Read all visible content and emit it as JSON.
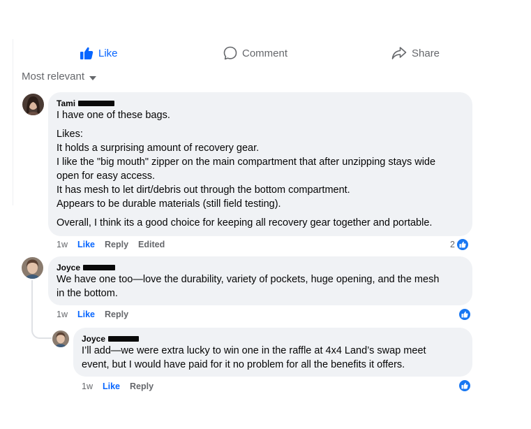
{
  "actions": {
    "like_label": "Like",
    "comment_label": "Comment",
    "share_label": "Share"
  },
  "sort": {
    "label": "Most relevant"
  },
  "comments": [
    {
      "author": "Tami",
      "paragraphs": [
        [
          "I have one of these bags."
        ],
        [
          "Likes:",
          "It holds a surprising amount of recovery gear.",
          "I like the \"big mouth\" zipper on the main compartment that after unzipping stays wide",
          "open for easy access.",
          "It has mesh to let dirt/debris out through the bottom compartment.",
          "Appears to be durable materials (still field testing)."
        ],
        [
          "Overall, I think its a good choice for keeping all recovery gear together and portable."
        ]
      ],
      "time": "1w",
      "like": "Like",
      "reply": "Reply",
      "edited": "Edited",
      "reaction_count": "2"
    },
    {
      "author": "Joyce",
      "lines": [
        "We have one too—love the durability, variety of pockets, huge opening, and the mesh",
        "in the bottom."
      ],
      "time": "1w",
      "like": "Like",
      "reply": "Reply"
    },
    {
      "author": "Joyce",
      "lines": [
        "I’ll add—we were extra lucky to win one in the raffle at 4x4 Land’s swap meet",
        "event, but I would have paid for it no problem for all the benefits it offers."
      ],
      "time": "1w",
      "like": "Like",
      "reply": "Reply"
    }
  ],
  "colors": {
    "accent": "#0866ff",
    "badge": "#1877f2",
    "bubble": "#f0f2f5",
    "muted": "#65676b"
  }
}
